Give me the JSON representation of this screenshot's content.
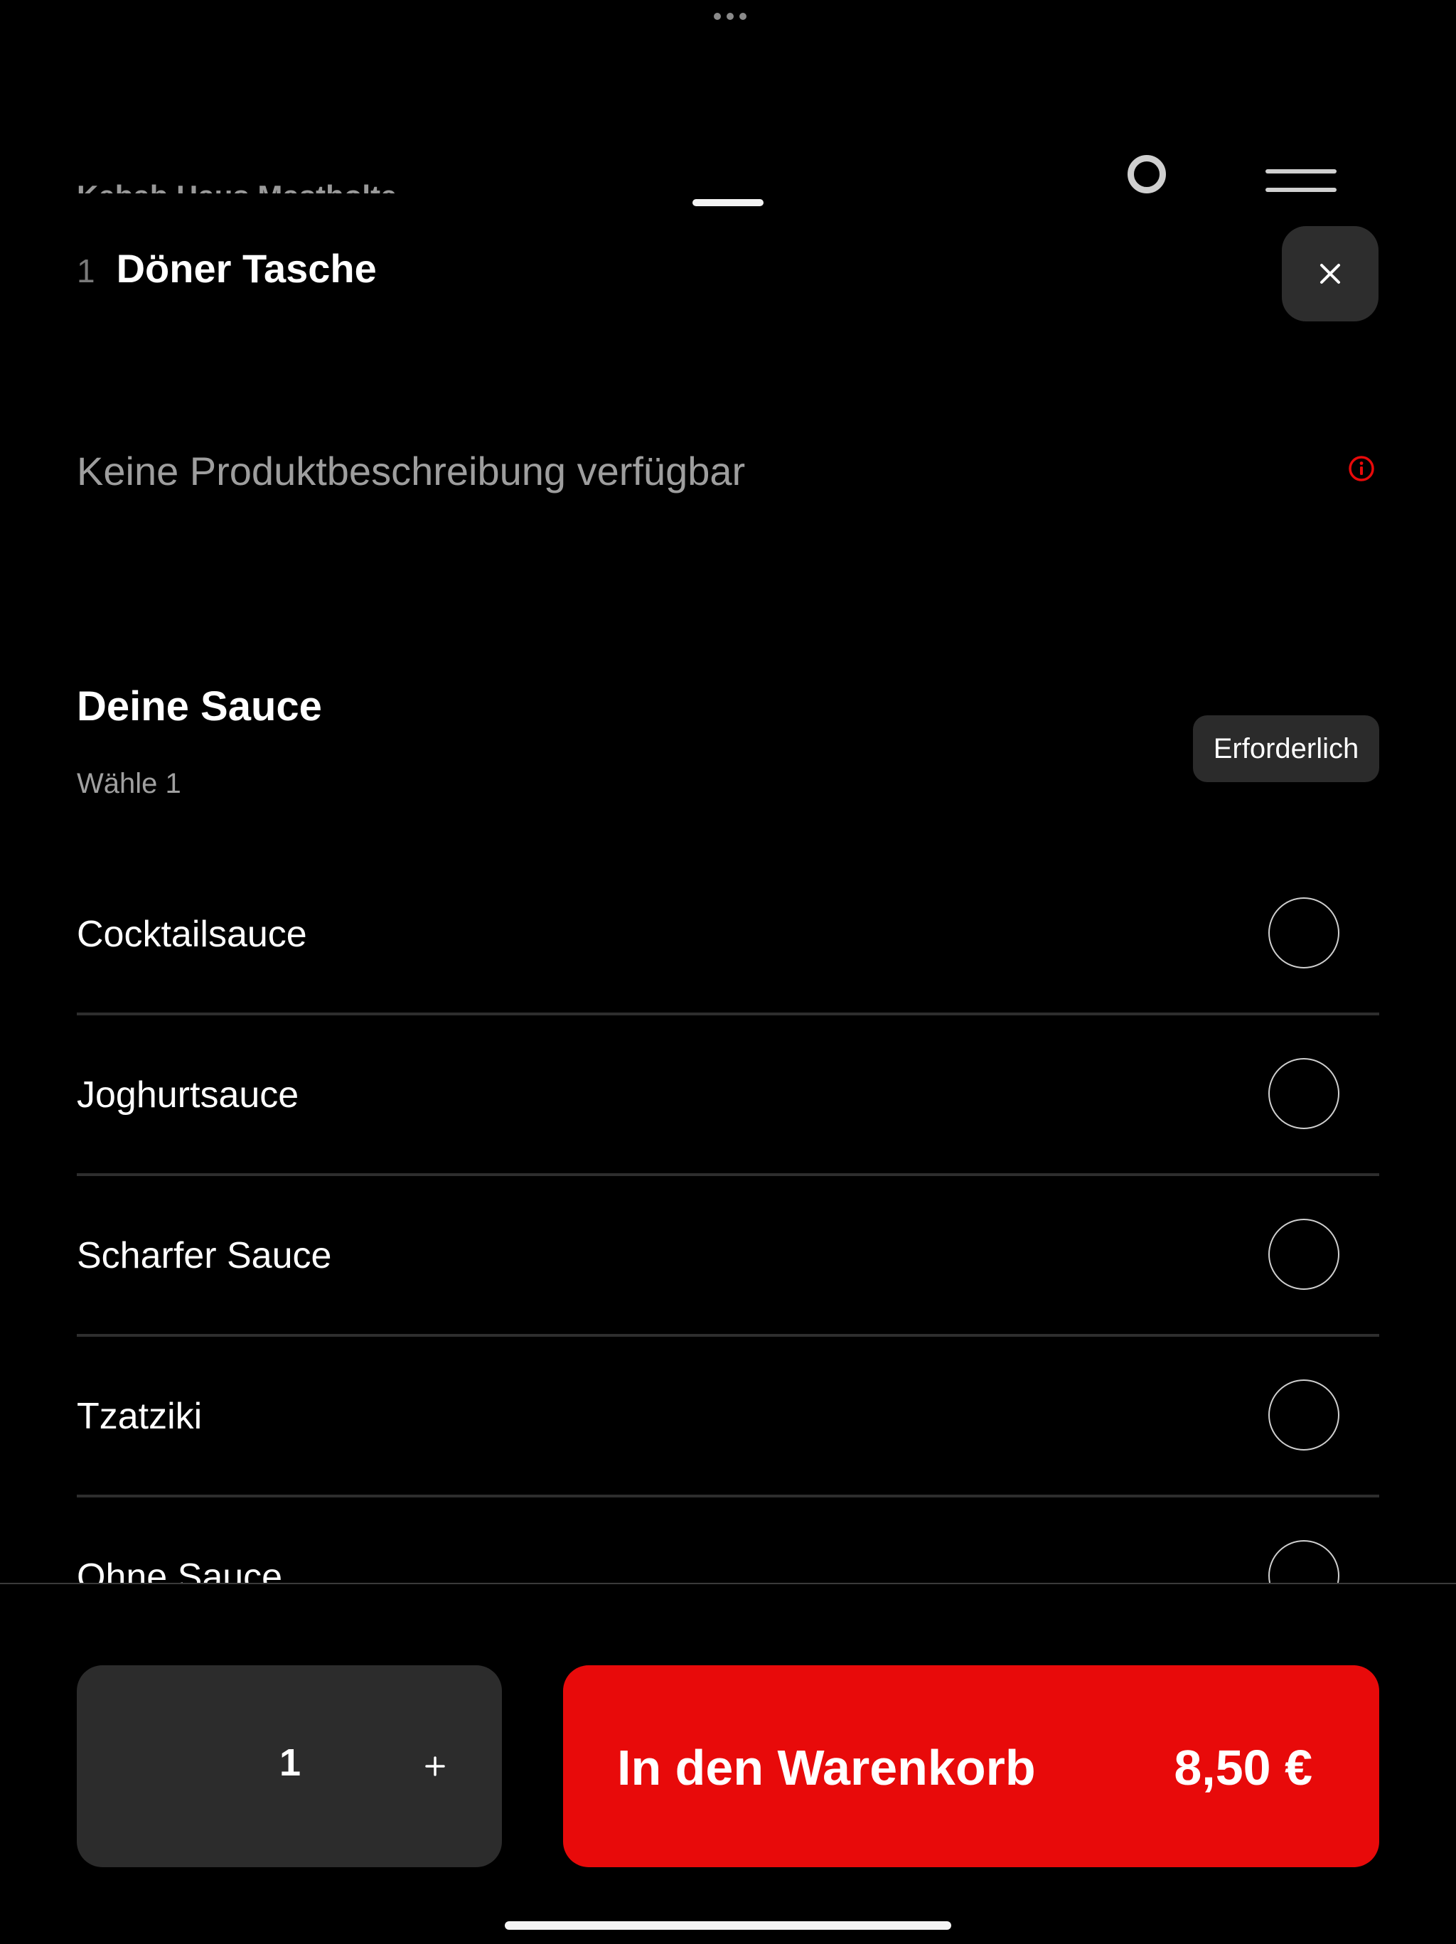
{
  "background_page": {
    "restaurant_name": "Kebab Haus Mastholte"
  },
  "product": {
    "quantity_prefix": "1",
    "title": "Döner Tasche",
    "description": "Keine Produktbeschreibung verfügbar"
  },
  "sauce_section": {
    "title": "Deine Sauce",
    "subtitle": "Wähle 1",
    "badge": "Erforderlich",
    "options": [
      {
        "label": "Cocktailsauce"
      },
      {
        "label": "Joghurtsauce"
      },
      {
        "label": "Scharfer Sauce"
      },
      {
        "label": "Tzatziki"
      },
      {
        "label": "Ohne Sauce"
      }
    ]
  },
  "footer": {
    "quantity": "1",
    "plus_symbol": "+",
    "add_to_cart_label": "In den Warenkorb",
    "price": "8,50 €"
  },
  "icons": {
    "close": "close-icon",
    "info": "info-icon",
    "plus": "plus-icon"
  },
  "colors": {
    "accent": "#e80a0a",
    "background": "#000000",
    "surface": "#2c2c2c",
    "muted_text": "#9e9e9e"
  }
}
